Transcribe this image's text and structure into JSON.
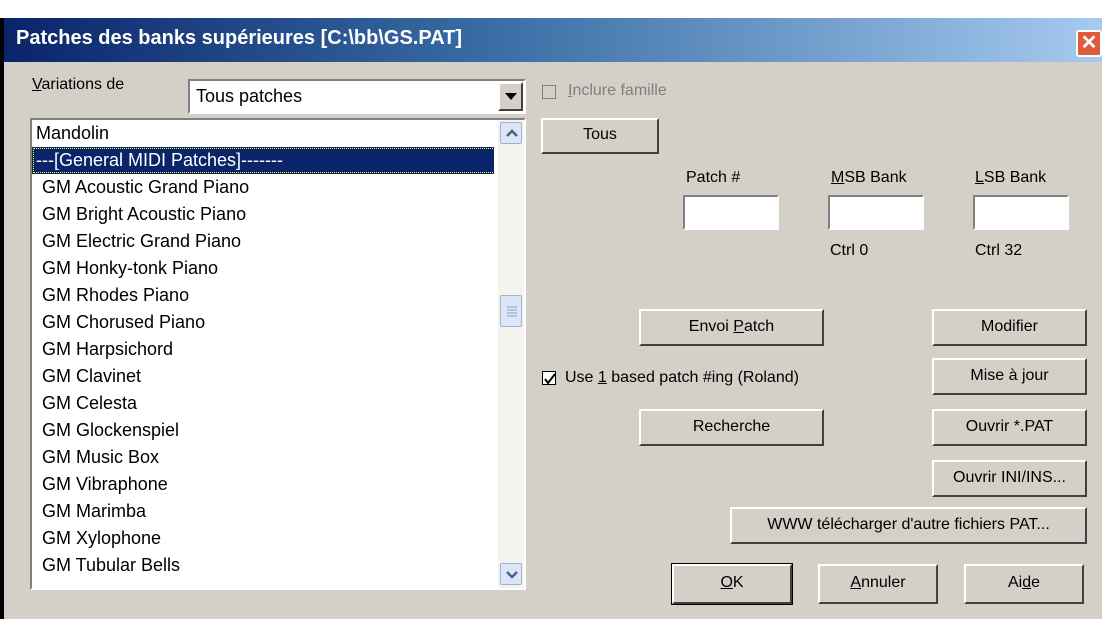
{
  "window": {
    "title": "Patches des banks supérieures [C:\\bb\\GS.PAT]",
    "close_glyph": "✕"
  },
  "variations": {
    "label_underline": "V",
    "label_rest": "ariations de",
    "selected": "Tous patches"
  },
  "include_family": {
    "label_underline": "I",
    "label_rest": "nclure famille",
    "checked": false,
    "enabled": false
  },
  "tous_button": "Tous",
  "patch_list": {
    "items": [
      "Mandolin",
      "---[General MIDI Patches]-------",
      "GM Acoustic Grand Piano",
      "GM Bright Acoustic Piano",
      "GM Electric Grand Piano",
      "GM Honky-tonk Piano",
      "GM Rhodes Piano",
      "GM Chorused Piano",
      "GM Harpsichord",
      "GM Clavinet",
      "GM Celesta",
      "GM Glockenspiel",
      "GM Music Box",
      "GM Vibraphone",
      "GM Marimba",
      "GM Xylophone",
      "GM Tubular Bells"
    ],
    "selected_index": 1
  },
  "patch_fields": {
    "patch_label": "Patch #",
    "msb_label_underline": "M",
    "msb_label_rest": "SB Bank",
    "lsb_label_underline": "L",
    "lsb_label_rest": "SB Bank",
    "patch_value": "",
    "msb_value": "",
    "lsb_value": "",
    "msb_note": "Ctrl 0",
    "lsb_note": "Ctrl 32"
  },
  "use_one_based": {
    "label_before": "Use ",
    "label_underline": "1",
    "label_after": " based patch #ing (Roland)",
    "checked": true
  },
  "buttons": {
    "envoi_before": "Envoi ",
    "envoi_underline": "P",
    "envoi_after": "atch",
    "recherche": "Recherche",
    "modifier": "Modifier",
    "mise_a_jour": "Mise à jour",
    "ouvrir_pat": "Ouvrir *.PAT",
    "ouvrir_ini": "Ouvrir INI/INS...",
    "www": "WWW télécharger d'autre fichiers PAT...",
    "ok_underline": "O",
    "ok_rest": "K",
    "annuler_underline": "A",
    "annuler_rest": "nnuler",
    "aide_before": "Ai",
    "aide_underline": "d",
    "aide_after": "e"
  }
}
